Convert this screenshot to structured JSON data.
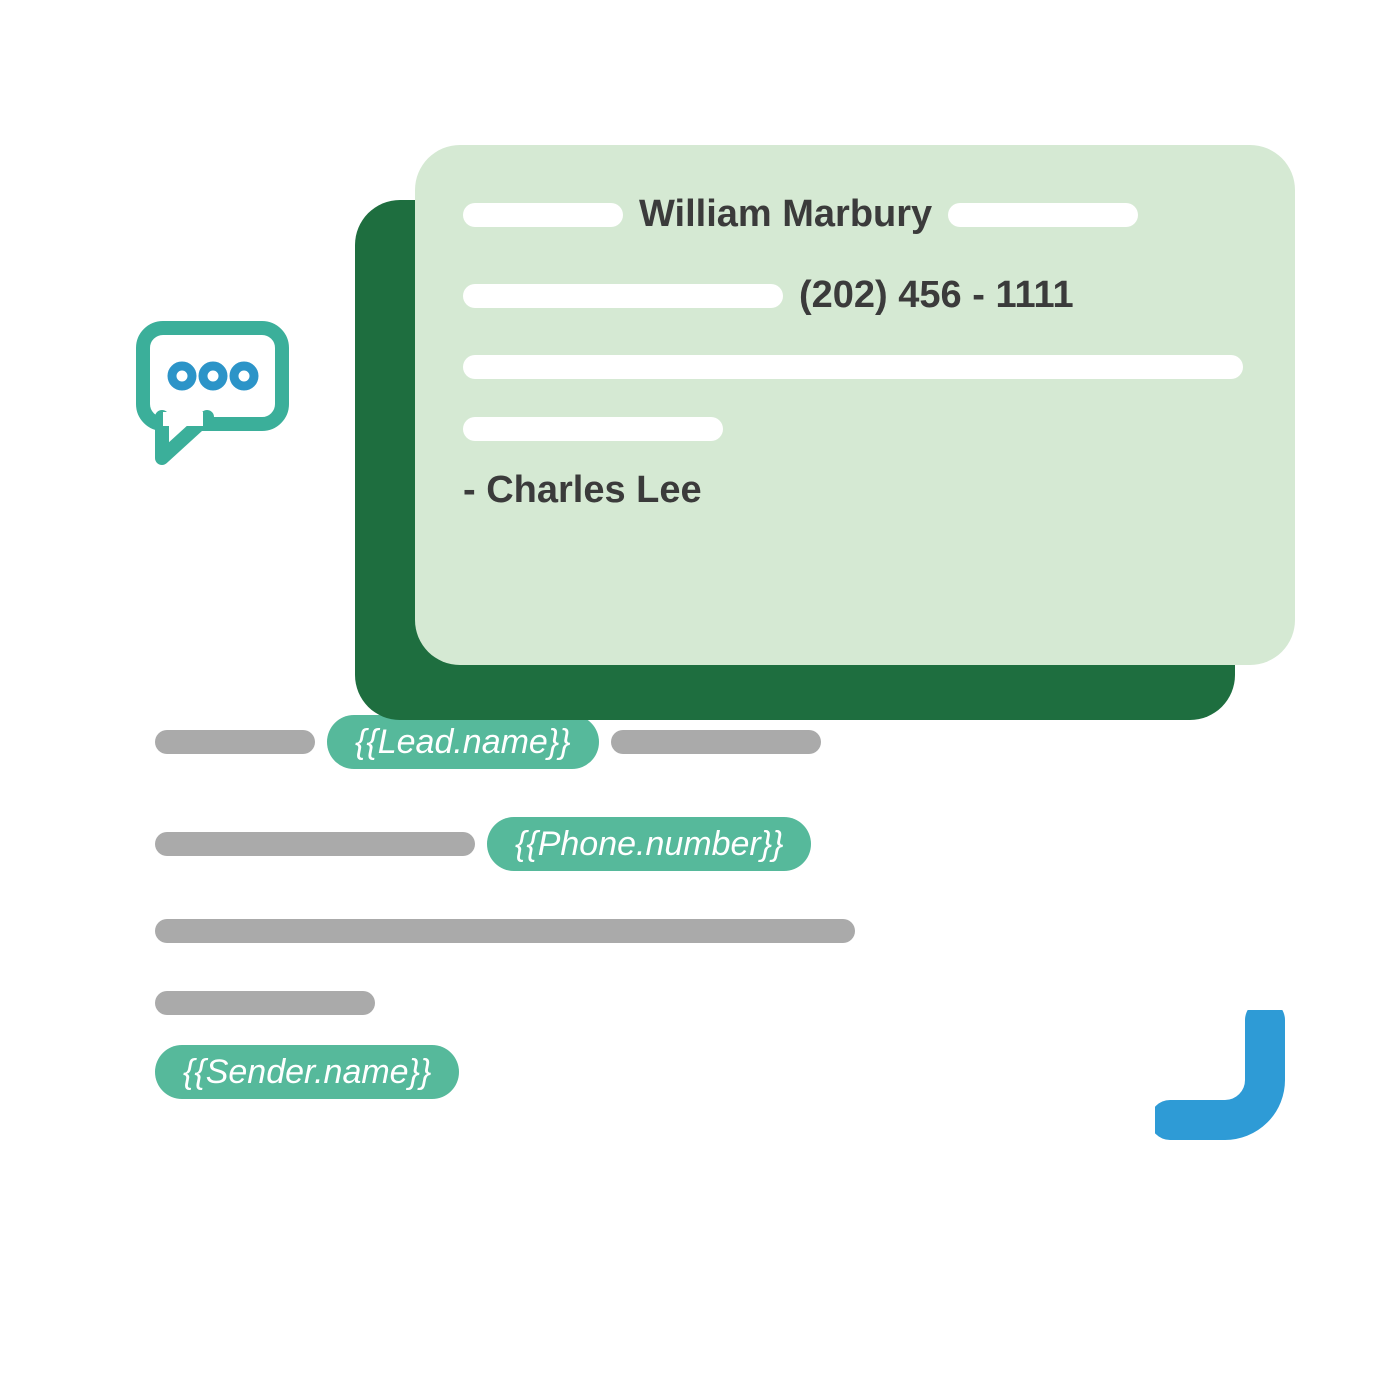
{
  "card": {
    "lead_name": "William Marbury",
    "phone": "(202) 456 - 1111",
    "signature_prefix": "- ",
    "sender_name": "Charles Lee"
  },
  "template": {
    "lead_token": "{{Lead.name}}",
    "phone_token": "{{Phone.number}}",
    "sender_token": "{{Sender.name}}"
  },
  "colors": {
    "teal": "#56b99b",
    "dark_green": "#1e6e3f",
    "light_green": "#d5e9d3",
    "grey": "#aaaaaa",
    "blue": "#2e9bd6",
    "icon_teal": "#3baf9a",
    "icon_blue": "#2c94c8"
  }
}
